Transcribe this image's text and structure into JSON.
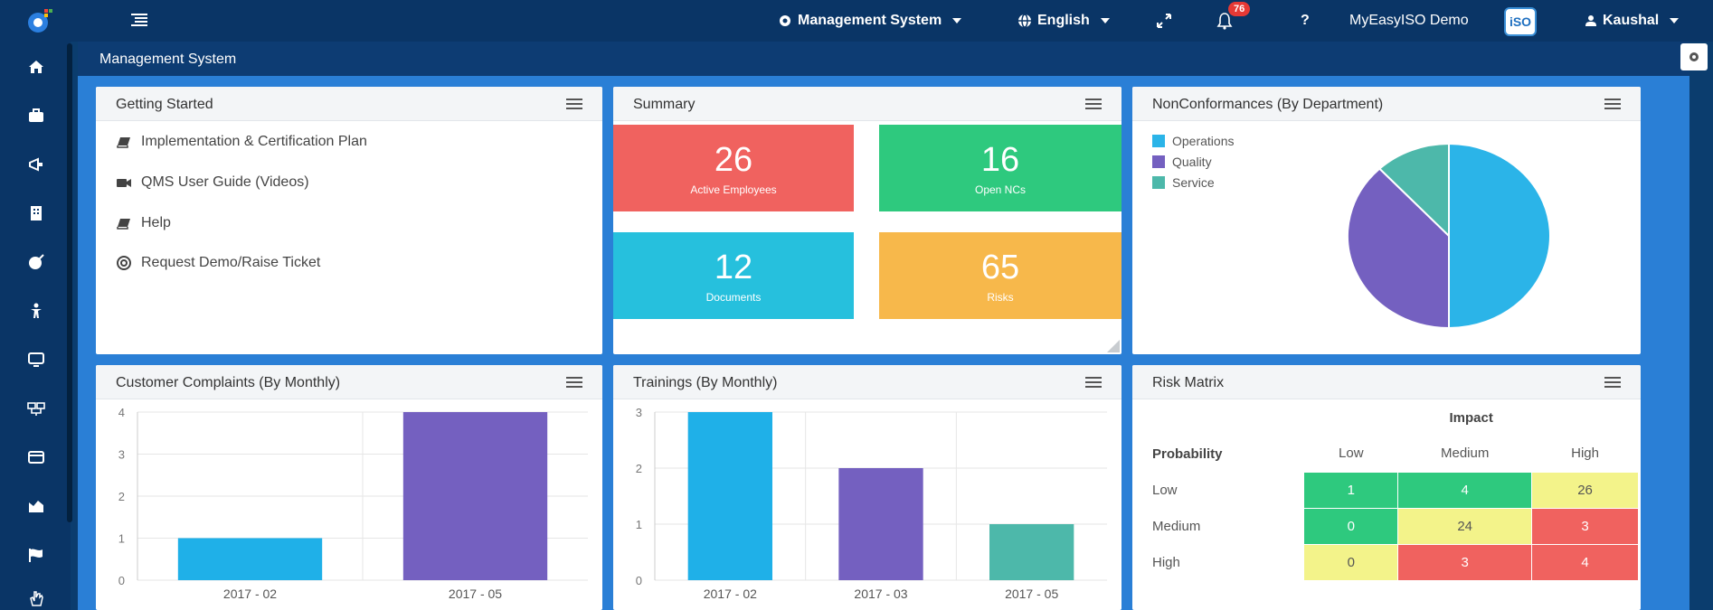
{
  "topbar": {
    "management_menu": "Management System",
    "language_menu": "English",
    "notification_count": "76",
    "help_label": "?",
    "account_name": "MyEasyISO Demo",
    "avatar_text": "iSO",
    "user_menu": "Kaushal"
  },
  "header": {
    "title": "Management System"
  },
  "getting_started": {
    "title": "Getting Started",
    "items": [
      "Implementation & Certification Plan",
      "QMS User Guide (Videos)",
      "Help",
      "Request Demo/Raise Ticket"
    ]
  },
  "summary": {
    "title": "Summary",
    "tiles": [
      {
        "value": "26",
        "label": "Active Employees",
        "color": "#f0625f"
      },
      {
        "value": "16",
        "label": "Open NCs",
        "color": "#2ec97e"
      },
      {
        "value": "12",
        "label": "Documents",
        "color": "#26c0dd"
      },
      {
        "value": "65",
        "label": "Risks",
        "color": "#f7b84b"
      }
    ]
  },
  "nonconformances": {
    "title": "NonConformances (By Department)",
    "chart_data": {
      "type": "pie",
      "labels": [
        "Operations",
        "Quality",
        "Service"
      ],
      "values": [
        50,
        38,
        12
      ],
      "colors": [
        "#2bb4e8",
        "#7460c0",
        "#4db8aa"
      ]
    }
  },
  "complaints": {
    "title": "Customer Complaints (By Monthly)",
    "chart_data": {
      "type": "bar",
      "categories": [
        "2017 - 02",
        "2017 - 05"
      ],
      "values": [
        1,
        4
      ],
      "colors": [
        "#1fb0e8",
        "#7460c0"
      ],
      "ylim": [
        0,
        4
      ],
      "yticks": [
        "0",
        "1",
        "2",
        "3",
        "4"
      ]
    }
  },
  "trainings": {
    "title": "Trainings (By Monthly)",
    "chart_data": {
      "type": "bar",
      "categories": [
        "2017 - 02",
        "2017 - 03",
        "2017 - 05"
      ],
      "values": [
        3,
        2,
        1
      ],
      "colors": [
        "#1fb0e8",
        "#7460c0",
        "#4db8aa"
      ],
      "ylim": [
        0,
        3
      ],
      "yticks": [
        "0",
        "1",
        "2",
        "3"
      ]
    }
  },
  "risk_matrix": {
    "title": "Risk Matrix",
    "impact_label": "Impact",
    "probability_label": "Probability",
    "impact_levels": [
      "Low",
      "Medium",
      "High"
    ],
    "rows": [
      {
        "label": "Low",
        "cells": [
          "1",
          "4",
          "26"
        ],
        "colors": [
          "#2ec97e",
          "#2ec97e",
          "#f3f38a"
        ]
      },
      {
        "label": "Medium",
        "cells": [
          "0",
          "24",
          "3"
        ],
        "colors": [
          "#2ec97e",
          "#f3f38a",
          "#f0625f"
        ]
      },
      {
        "label": "High",
        "cells": [
          "0",
          "3",
          "4"
        ],
        "colors": [
          "#f3f38a",
          "#f0625f",
          "#f0625f"
        ]
      }
    ]
  }
}
